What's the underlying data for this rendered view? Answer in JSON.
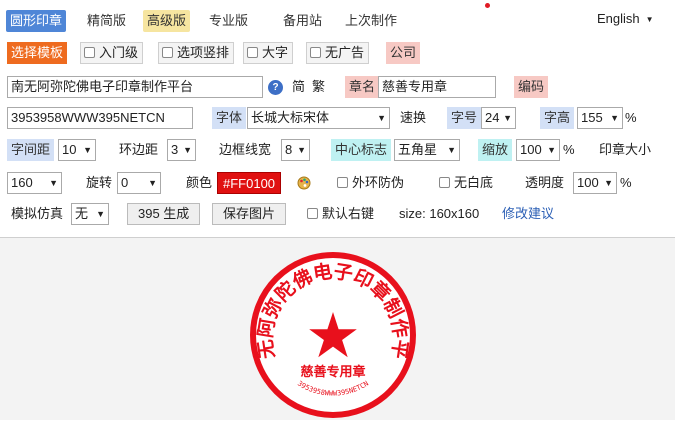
{
  "nav": {
    "tabs": [
      {
        "label": "圆形印章"
      },
      {
        "label": "精简版"
      },
      {
        "label": "高级版"
      },
      {
        "label": "专业版"
      },
      {
        "label": "备用站"
      },
      {
        "label": "上次制作"
      }
    ],
    "language": "English"
  },
  "row1": {
    "select_template": "选择模板",
    "options": [
      "入门级",
      "选项竖排",
      "大字",
      "无广告"
    ],
    "company": "公司"
  },
  "row2": {
    "main_text": "南无阿弥陀佛电子印章制作平台",
    "simplified": "简",
    "traditional": "繁",
    "seal_name_label": "章名",
    "seal_name_value": "慈善专用章",
    "code_label": "编码"
  },
  "row3": {
    "code_value": "3953958WWW395NETCN",
    "font_label": "字体",
    "font_value": "长城大标宋体",
    "speed_label": "速换",
    "size_label": "字号",
    "size_value": "24",
    "height_label": "字高",
    "height_value": "155",
    "percent": "%"
  },
  "row4": {
    "spacing_label": "字间距",
    "spacing_value": "10",
    "ring_margin_label": "环边距",
    "ring_margin_value": "3",
    "border_width_label": "边框线宽",
    "border_width_value": "8",
    "center_mark_label": "中心标志",
    "center_mark_value": "五角星",
    "scale_label": "缩放",
    "scale_value": "100",
    "percent": "%",
    "seal_size_label": "印章大小"
  },
  "row5": {
    "seal_size_value": "160",
    "rotate_label": "旋转",
    "rotate_value": "0",
    "color_label": "颜色",
    "color_value": "#FF0100",
    "outer_anti_fake": "外环防伪",
    "no_white_bg": "无白底",
    "opacity_label": "透明度",
    "opacity_value": "100",
    "percent": "%"
  },
  "row6": {
    "simulate_label": "模拟仿真",
    "simulate_value": "无",
    "generate_button": "395 生成",
    "save_button": "保存图片",
    "default_right_click": "默认右键",
    "size_text": "size: 160x160",
    "suggest_link": "修改建议"
  },
  "seal": {
    "color": "#e8101c",
    "arc_text": "南无阿弥陀佛电子印章制作平台",
    "name_text": "慈善专用章",
    "code_text": "3953958WWW395NETCN"
  },
  "colors": {
    "accent_blue": "#4f86d7",
    "orange": "#ee6b1f",
    "seal_red": "#e8101c"
  }
}
